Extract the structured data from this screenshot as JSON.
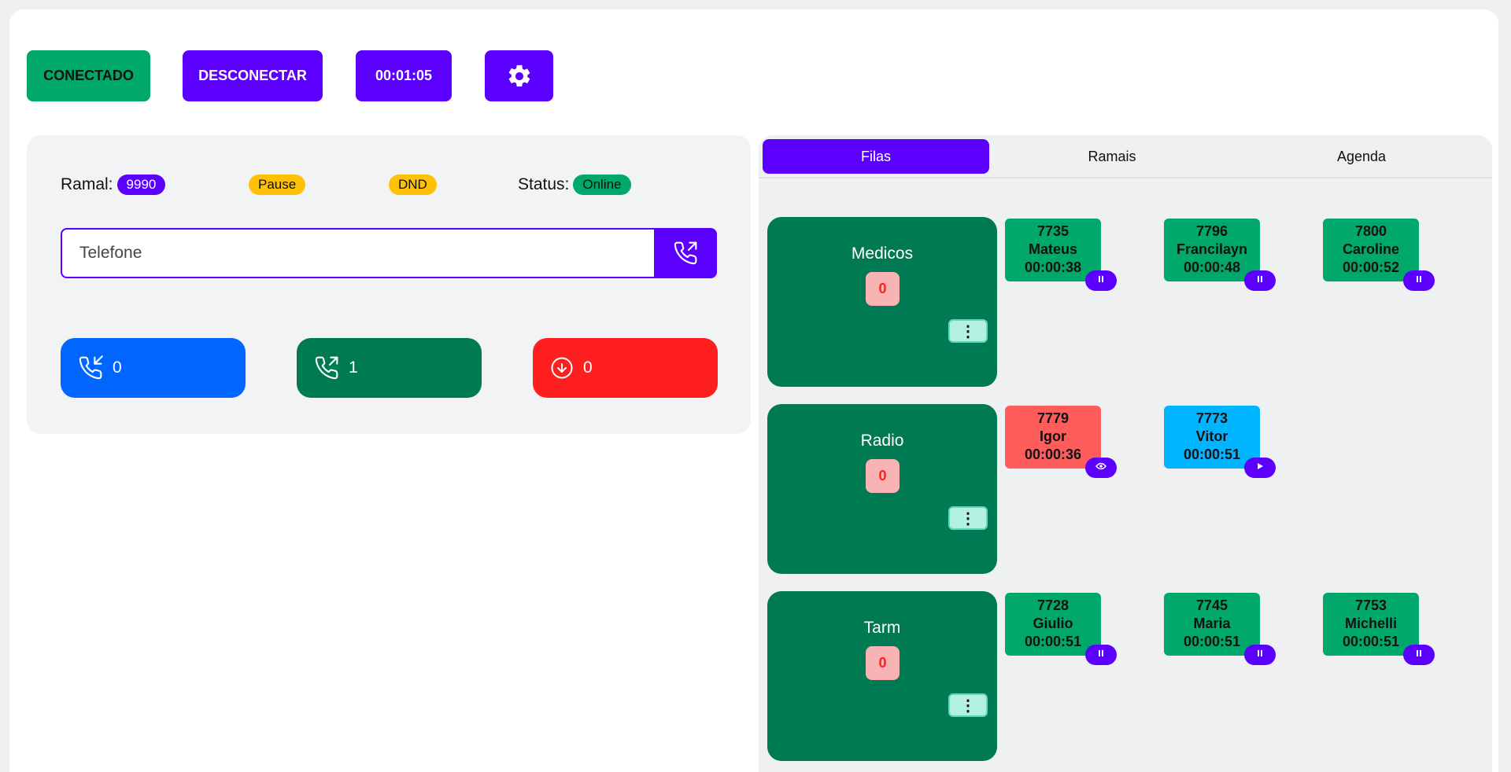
{
  "topbar": {
    "connected_label": "CONECTADO",
    "disconnect_label": "DESCONECTAR",
    "timer": "00:01:05",
    "settings_icon": "gear-icon"
  },
  "status_panel": {
    "ramal_label": "Ramal:",
    "ramal_value": "9990",
    "pause_label": "Pause",
    "dnd_label": "DND",
    "status_label": "Status:",
    "status_value": "Online"
  },
  "dialer": {
    "placeholder": "Telefone",
    "value": ""
  },
  "counters": {
    "incoming": "0",
    "outgoing": "1",
    "missed": "0"
  },
  "tabs": [
    {
      "label": "Filas",
      "active": true
    },
    {
      "label": "Ramais",
      "active": false
    },
    {
      "label": "Agenda",
      "active": false
    }
  ],
  "queues": [
    {
      "name": "Medicos",
      "count": "0",
      "menu": "⋮",
      "agents": [
        {
          "ext": "7735",
          "name": "Mateus",
          "time": "00:00:38",
          "color": "green",
          "action": "pause-icon"
        },
        {
          "ext": "7796",
          "name": "Francilayn",
          "time": "00:00:48",
          "color": "green",
          "action": "pause-icon"
        },
        {
          "ext": "7800",
          "name": "Caroline",
          "time": "00:00:52",
          "color": "green",
          "action": "pause-icon"
        }
      ]
    },
    {
      "name": "Radio",
      "count": "0",
      "menu": "⋮",
      "agents": [
        {
          "ext": "7779",
          "name": "Igor",
          "time": "00:00:36",
          "color": "red",
          "action": "eye-icon"
        },
        {
          "ext": "7773",
          "name": "Vitor",
          "time": "00:00:51",
          "color": "blue",
          "action": "play-icon"
        }
      ]
    },
    {
      "name": "Tarm",
      "count": "0",
      "menu": "⋮",
      "agents": [
        {
          "ext": "7728",
          "name": "Giulio",
          "time": "00:00:51",
          "color": "green",
          "action": "pause-icon"
        },
        {
          "ext": "7745",
          "name": "Maria",
          "time": "00:00:51",
          "color": "green",
          "action": "pause-icon"
        },
        {
          "ext": "7753",
          "name": "Michelli",
          "time": "00:00:51",
          "color": "green",
          "action": "pause-icon"
        }
      ]
    }
  ],
  "colors": {
    "accent": "#5b00ff",
    "connected": "#00a86b",
    "queue_bg": "#007a52",
    "incoming": "#0066ff",
    "outgoing": "#007a52",
    "missed": "#ff1f1f",
    "warning": "#ffc107"
  }
}
